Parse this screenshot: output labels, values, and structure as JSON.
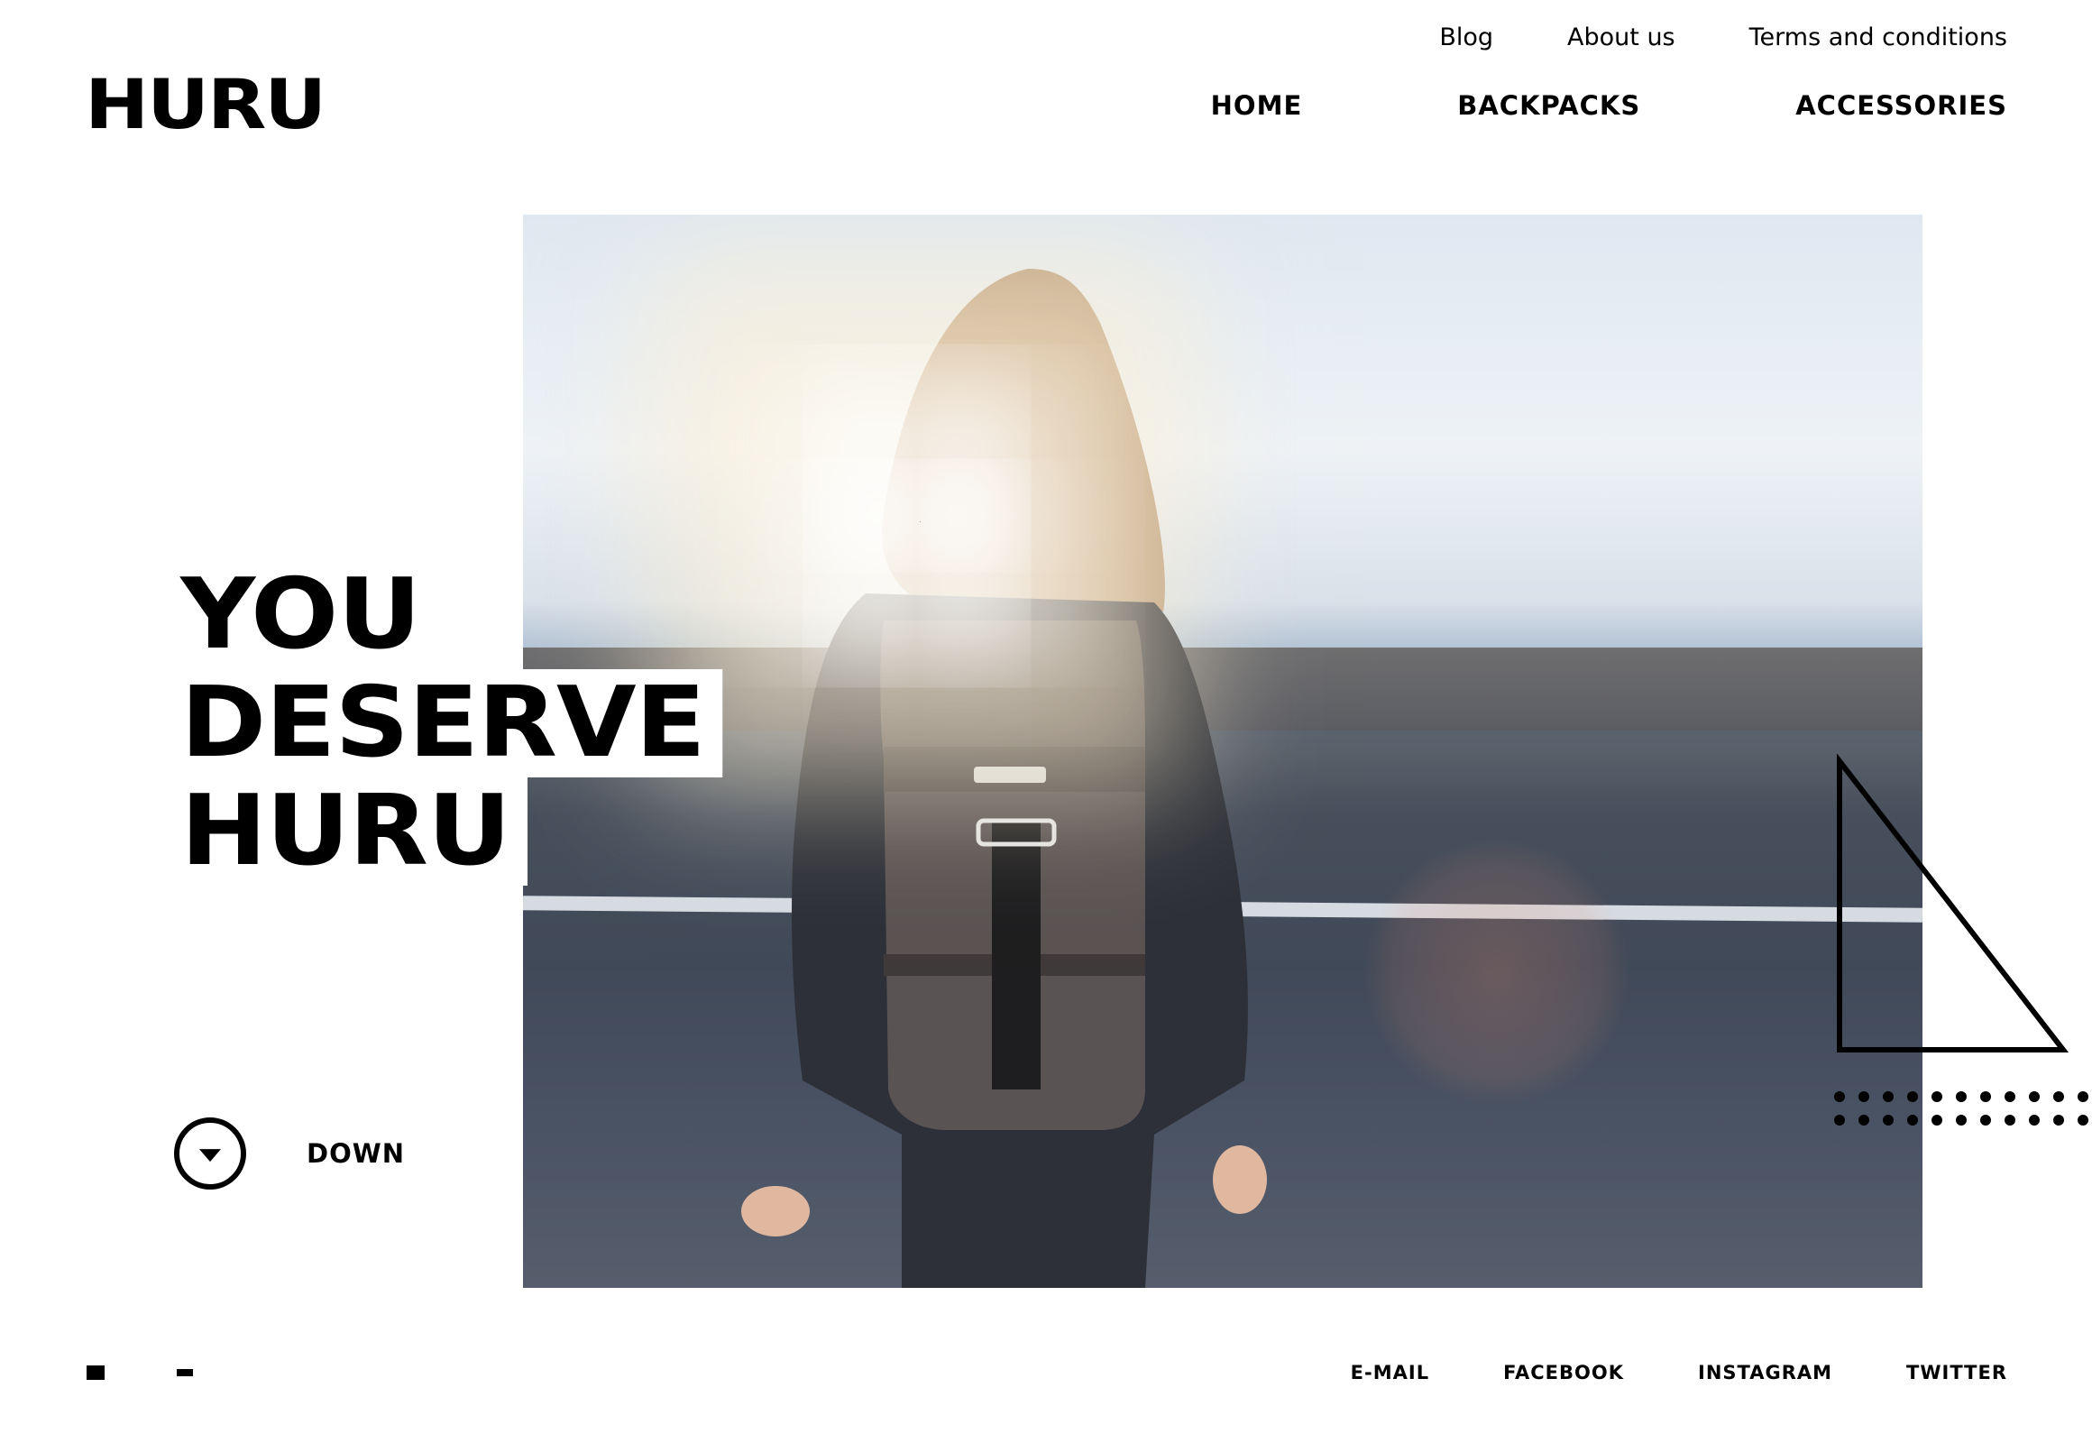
{
  "brand": {
    "logo_text": "HURU"
  },
  "utility_nav": {
    "items": [
      "Blog",
      "About us",
      "Terms and conditions"
    ]
  },
  "main_nav": {
    "items": [
      "HOME",
      "BACKPACKS",
      "ACCESSORIES"
    ]
  },
  "hero": {
    "headline_lines": [
      "YOU",
      "DESERVE",
      "HURU"
    ],
    "down_label": "DOWN"
  },
  "footer": {
    "social": [
      "E-MAIL",
      "FACEBOOK",
      "INSTAGRAM",
      "TWITTER"
    ]
  },
  "colors": {
    "text": "#000000",
    "background": "#ffffff"
  }
}
